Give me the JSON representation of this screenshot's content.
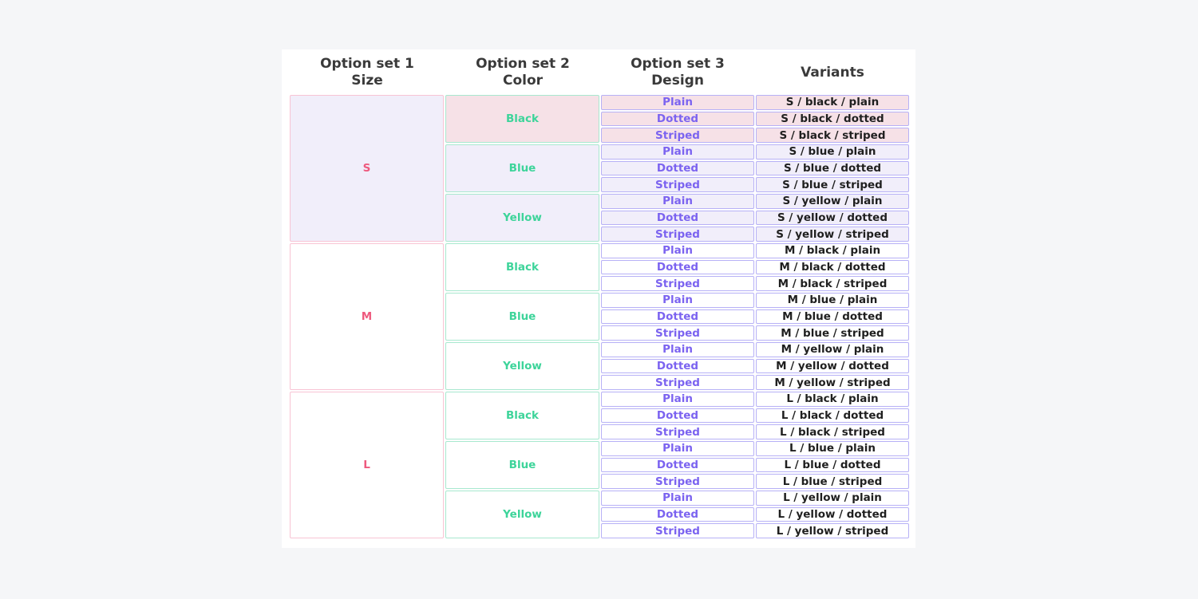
{
  "headers": [
    {
      "line1": "Option set 1",
      "line2": "Size"
    },
    {
      "line1": "Option set 2",
      "line2": "Color"
    },
    {
      "line1": "Option set 3",
      "line2": "Design"
    },
    {
      "line1": "Variants",
      "line2": ""
    }
  ],
  "sizes": [
    "S",
    "M",
    "L"
  ],
  "colors": [
    "Black",
    "Blue",
    "Yellow"
  ],
  "designs": [
    "Plain",
    "Dotted",
    "Striped"
  ],
  "variants": [
    "S / black / plain",
    "S / black / dotted",
    "S / black / striped",
    "S / blue / plain",
    "S / blue / dotted",
    "S / blue / striped",
    "S / yellow / plain",
    "S / yellow / dotted",
    "S / yellow / striped",
    "M / black / plain",
    "M / black / dotted",
    "M / black / striped",
    "M / blue / plain",
    "M / blue / dotted",
    "M / blue / striped",
    "M / yellow / plain",
    "M / yellow / dotted",
    "M / yellow / striped",
    "L / black / plain",
    "L / black / dotted",
    "L / black / striped",
    "L / blue / plain",
    "L / blue / dotted",
    "L / blue / striped",
    "L / yellow / plain",
    "L / yellow / dotted",
    "L / yellow / striped"
  ],
  "highlight": {
    "size_index": 0,
    "color_index": 0
  },
  "palette": {
    "size_text": "#ee5a7e",
    "color_text": "#3dd49a",
    "design_text": "#7b63f0",
    "variant_text": "#1f1f1f",
    "highlight_pink": "#f6e1e7",
    "highlight_lavender": "#f1eefa"
  }
}
